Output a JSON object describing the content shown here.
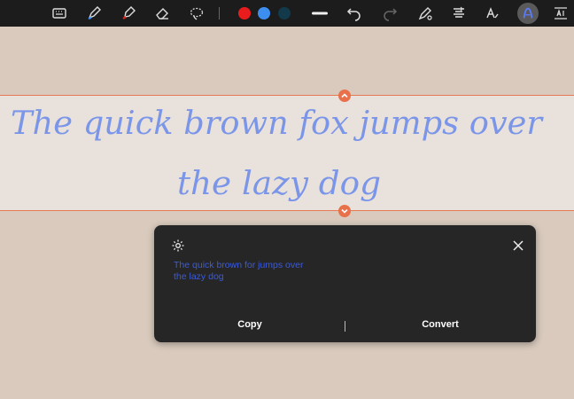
{
  "toolbar": {
    "tools": [
      {
        "name": "keyboard-icon"
      },
      {
        "name": "pen-icon"
      },
      {
        "name": "highlighter-icon"
      },
      {
        "name": "eraser-icon"
      },
      {
        "name": "lasso-icon"
      }
    ],
    "colors": [
      "#e81c1c",
      "#3d8fef",
      "#123a4a"
    ],
    "actions": [
      {
        "name": "pen-thickness-icon"
      },
      {
        "name": "undo-icon"
      },
      {
        "name": "redo-icon"
      },
      {
        "name": "pen-settings-icon"
      },
      {
        "name": "text-align-icon"
      },
      {
        "name": "handwriting-text-icon"
      },
      {
        "name": "handwriting-to-text-icon"
      },
      {
        "name": "text-spacing-icon"
      }
    ]
  },
  "canvas": {
    "handwritten_text": [
      "The quick brown fox jumps over",
      "the lazy dog"
    ],
    "ink_color": "#7b96e8",
    "selection_border_color": "#e67a55"
  },
  "conversion_panel": {
    "recognized_text": "The quick brown for jumps over the lazy dog",
    "copy_label": "Copy",
    "convert_label": "Convert",
    "text_color": "#3b5bdb"
  }
}
